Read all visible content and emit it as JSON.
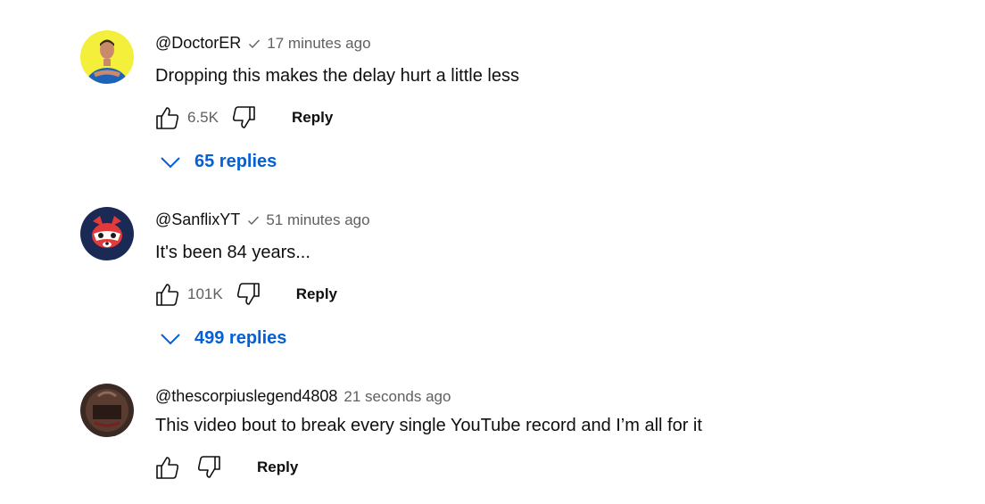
{
  "comments": [
    {
      "author": "@DoctorER",
      "verified": true,
      "time": "17 minutes ago",
      "text": "Dropping this makes the delay hurt a little less",
      "likes": "6.5K",
      "reply_label": "Reply",
      "replies_label": "65 replies",
      "avatar": "doctor-avatar"
    },
    {
      "author": "@SanflixYT",
      "verified": true,
      "time": "51 minutes ago",
      "text": "It's been 84 years...",
      "likes": "101K",
      "reply_label": "Reply",
      "replies_label": "499 replies",
      "avatar": "raccoon-avatar"
    },
    {
      "author": "@thescorpiuslegend4808",
      "verified": false,
      "time": "21 seconds ago",
      "text": "This video bout to break every single YouTube record and I’m all for it",
      "likes": "",
      "reply_label": "Reply",
      "avatar": "scorpius-avatar"
    }
  ],
  "colors": {
    "link_blue": "#065fd4",
    "meta_gray": "#606060",
    "text": "#0f0f0f"
  }
}
